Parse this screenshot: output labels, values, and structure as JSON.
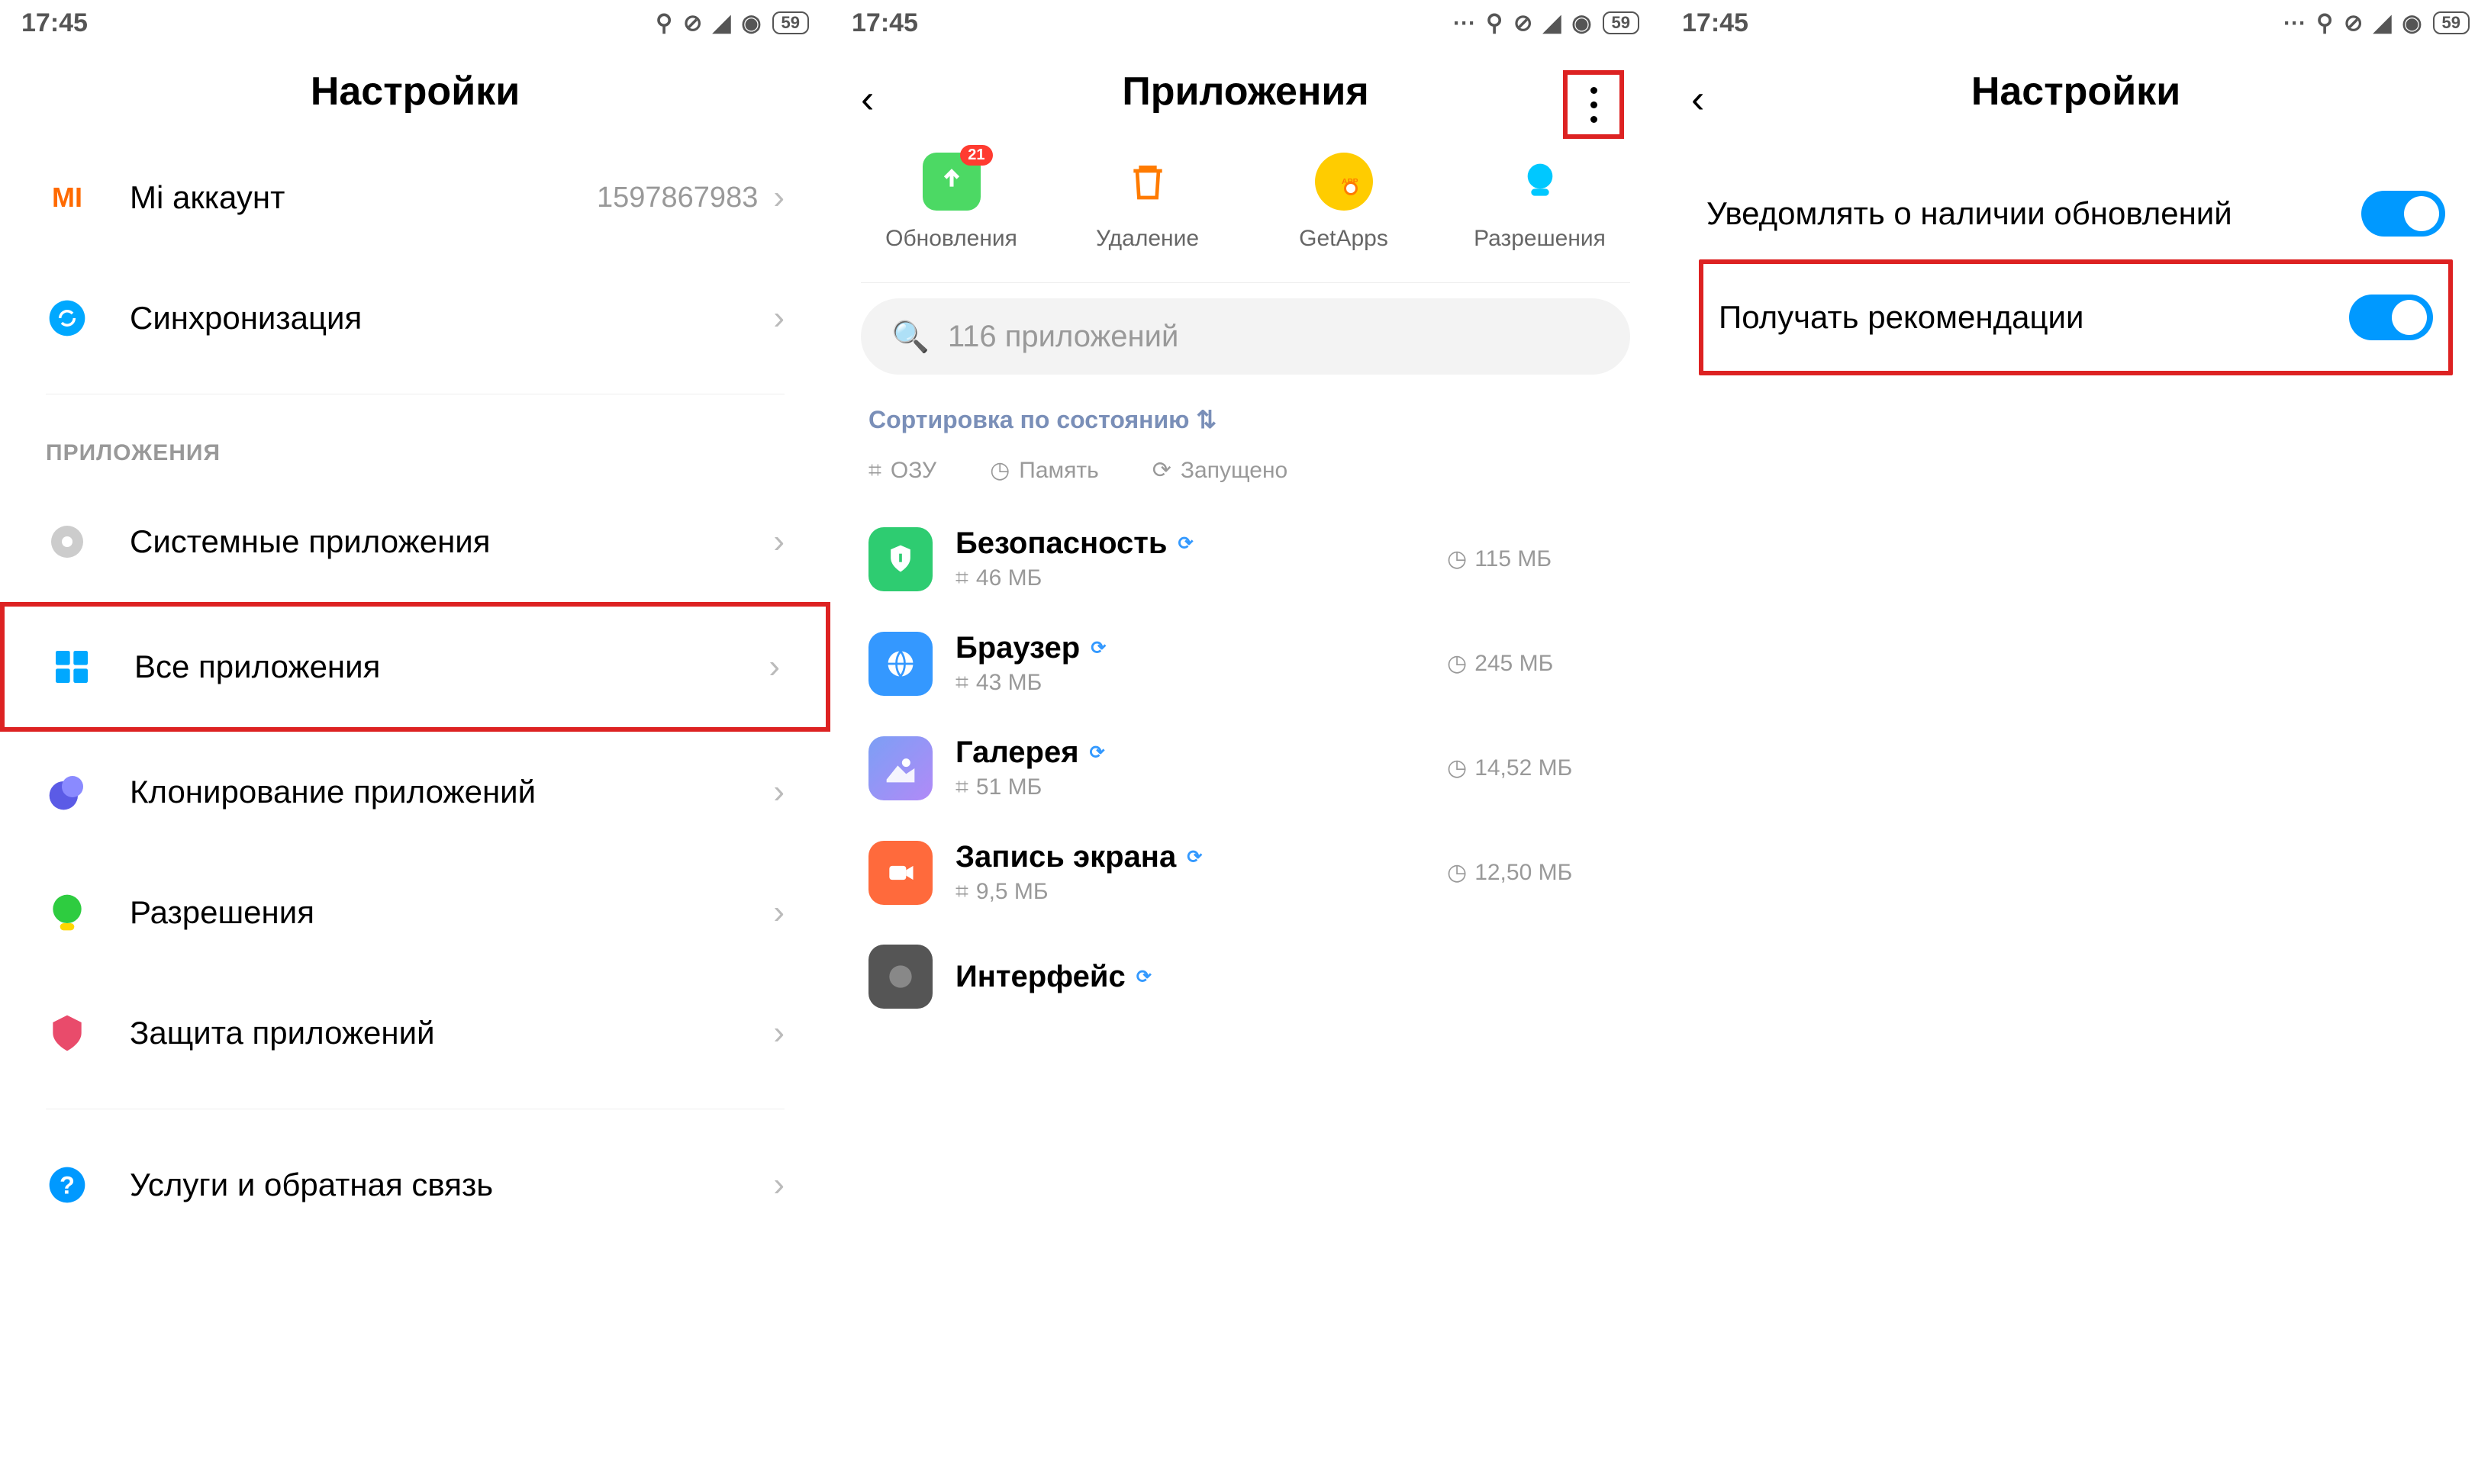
{
  "status": {
    "time": "17:45",
    "battery": "59"
  },
  "panel1": {
    "title": "Настройки",
    "mi": {
      "label": "Mi аккаунт",
      "value": "1597867983"
    },
    "sync": {
      "label": "Синхронизация"
    },
    "section": "ПРИЛОЖЕНИЯ",
    "rows": {
      "system": "Системные приложения",
      "all": "Все приложения",
      "clone": "Клонирование приложений",
      "perm": "Разрешения",
      "protect": "Защита приложений",
      "feedback": "Услуги и обратная связь"
    }
  },
  "panel2": {
    "title": "Приложения",
    "top": {
      "updates": {
        "label": "Обновления",
        "badge": "21"
      },
      "delete": "Удаление",
      "getapps": "GetApps",
      "perms": "Разрешения"
    },
    "search": "116 приложений",
    "sort": "Сортировка по состоянию",
    "stats": {
      "ram": "ОЗУ",
      "mem": "Память",
      "run": "Запущено"
    },
    "apps": [
      {
        "name": "Безопасность",
        "ram": "46 МБ",
        "stor": "115 МБ"
      },
      {
        "name": "Браузер",
        "ram": "43 МБ",
        "stor": "245 МБ"
      },
      {
        "name": "Галерея",
        "ram": "51 МБ",
        "stor": "14,52 МБ"
      },
      {
        "name": "Запись экрана",
        "ram": "9,5 МБ",
        "stor": "12,50 МБ"
      },
      {
        "name": "Интерфейс",
        "ram": "",
        "stor": ""
      }
    ]
  },
  "panel3": {
    "title": "Настройки",
    "opts": {
      "notify": "Уведомлять о наличии обновлений",
      "reco": "Получать рекомендации"
    }
  }
}
